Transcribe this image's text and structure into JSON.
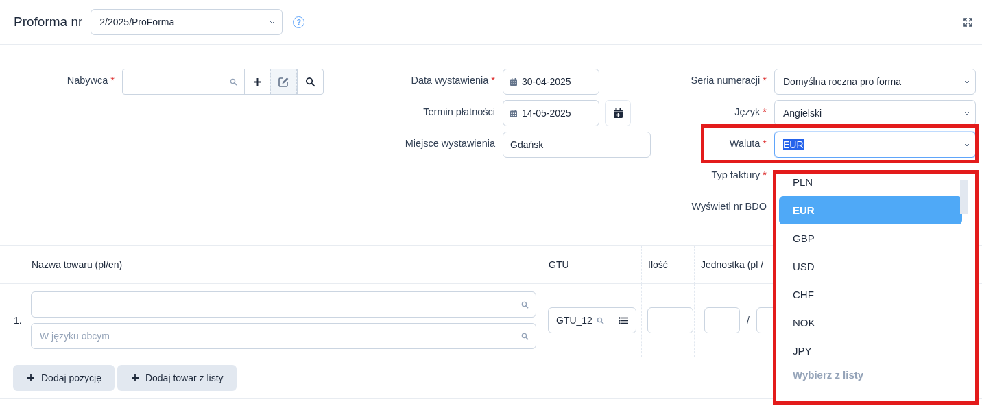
{
  "header": {
    "title": "Proforma nr",
    "number_select": {
      "value": "2/2025/ProForma"
    },
    "help": "?"
  },
  "buyer": {
    "label": "Nabywca",
    "mark": "*"
  },
  "dates": [
    {
      "kind": "date",
      "label": "Data wystawienia",
      "mark": "*",
      "value": "30-04-2025"
    },
    {
      "kind": "date_with_button",
      "label": "Termin płatności",
      "value": "14-05-2025"
    },
    {
      "kind": "text",
      "label": "Miejsce wystawienia",
      "value": "Gdańsk"
    }
  ],
  "settings": [
    {
      "kind": "select",
      "label": "Seria numeracji",
      "mark": "*",
      "value": "Domyślna roczna pro forma",
      "focused": false,
      "highlighted": false
    },
    {
      "kind": "select",
      "label": "Język",
      "mark": "*",
      "value": "Angielski",
      "focused": false,
      "highlighted": false
    },
    {
      "kind": "select",
      "label": "Waluta",
      "mark": "*",
      "value": "EUR",
      "focused": true,
      "highlighted": true
    },
    {
      "kind": "label_only",
      "label": "Typ faktury",
      "mark": "*"
    },
    {
      "kind": "label_only",
      "label": "Wyświetl nr BDO"
    }
  ],
  "currency_dropdown": {
    "highlighted": true,
    "options": [
      {
        "label": "PLN",
        "selected": false
      },
      {
        "label": "EUR",
        "selected": true
      },
      {
        "label": "GBP",
        "selected": false
      },
      {
        "label": "USD",
        "selected": false
      },
      {
        "label": "CHF",
        "selected": false
      },
      {
        "label": "NOK",
        "selected": false
      },
      {
        "label": "JPY",
        "selected": false
      }
    ],
    "hint": "Wybierz z listy"
  },
  "table": {
    "columns": [
      "Nazwa towaru (pl/en)",
      "GTU",
      "Ilość",
      "Jednostka (pl /"
    ],
    "rows": [
      {
        "number": "1.",
        "foreign_name_placeholder": "W języku obcym",
        "gtu": "GTU_12",
        "unit_separator": "/"
      }
    ]
  },
  "buttons": [
    {
      "label": "Dodaj pozycję"
    },
    {
      "label": "Dodaj towar z listy"
    }
  ]
}
